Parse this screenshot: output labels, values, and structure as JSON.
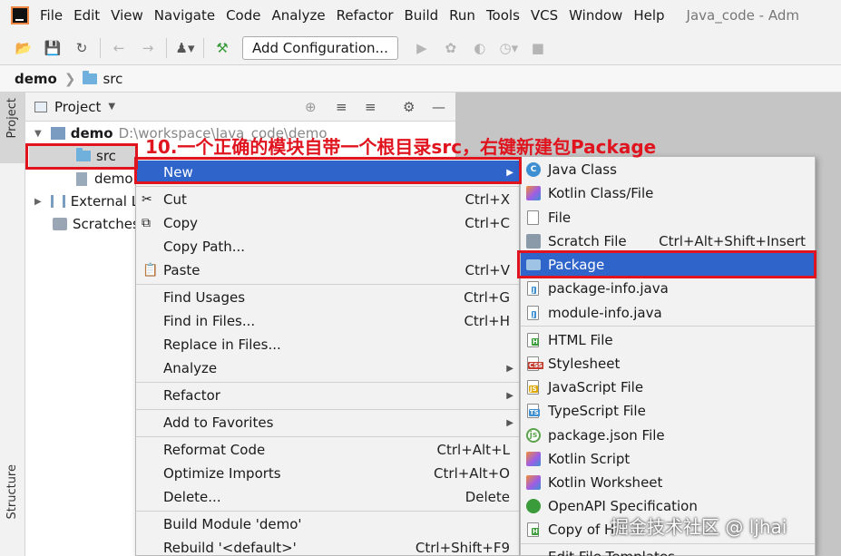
{
  "menubar": {
    "items": [
      "File",
      "Edit",
      "View",
      "Navigate",
      "Code",
      "Analyze",
      "Refactor",
      "Build",
      "Run",
      "Tools",
      "VCS",
      "Window",
      "Help"
    ],
    "window_title": "Java_code - Adm"
  },
  "toolbar": {
    "run_config_label": "Add Configuration...",
    "icons": [
      "open-icon",
      "save-icon",
      "sync-icon",
      "back-icon",
      "forward-icon",
      "user-icon",
      "build-hammer-icon",
      "run-icon",
      "debug-icon",
      "coverage-icon",
      "profile-icon",
      "stop-icon"
    ]
  },
  "breadcrumb": {
    "project": "demo",
    "folder": "src"
  },
  "side_strip": {
    "project_tab": "Project",
    "structure_tab": "Structure"
  },
  "project_panel": {
    "title": "Project",
    "tree": {
      "root_name": "demo",
      "root_path": "D:\\workspace\\Java_code\\demo",
      "src": "src",
      "iml": "demo",
      "external": "External L",
      "scratches": "Scratches"
    }
  },
  "annotation": "10.一个正确的模块自带一个根目录src，右键新建包Package",
  "context_menu": {
    "new": "New",
    "cut": "Cut",
    "cut_sc": "Ctrl+X",
    "copy": "Copy",
    "copy_sc": "Ctrl+C",
    "copy_path": "Copy Path...",
    "paste": "Paste",
    "paste_sc": "Ctrl+V",
    "find_usages": "Find Usages",
    "find_usages_sc": "Ctrl+G",
    "find_in_files": "Find in Files...",
    "find_in_files_sc": "Ctrl+H",
    "replace_in_files": "Replace in Files...",
    "analyze": "Analyze",
    "refactor": "Refactor",
    "add_to_favorites": "Add to Favorites",
    "reformat_code": "Reformat Code",
    "reformat_code_sc": "Ctrl+Alt+L",
    "optimize_imports": "Optimize Imports",
    "optimize_imports_sc": "Ctrl+Alt+O",
    "delete": "Delete...",
    "delete_sc": "Delete",
    "build_module": "Build Module 'demo'",
    "rebuild": "Rebuild '<default>'",
    "rebuild_sc": "Ctrl+Shift+F9"
  },
  "new_submenu": {
    "java_class": "Java Class",
    "kotlin_class": "Kotlin Class/File",
    "file": "File",
    "scratch_file": "Scratch File",
    "scratch_file_sc": "Ctrl+Alt+Shift+Insert",
    "package": "Package",
    "package_info": "package-info.java",
    "module_info": "module-info.java",
    "html_file": "HTML File",
    "stylesheet": "Stylesheet",
    "javascript_file": "JavaScript File",
    "typescript_file": "TypeScript File",
    "package_json": "package.json File",
    "kotlin_script": "Kotlin Script",
    "kotlin_worksheet": "Kotlin Worksheet",
    "openapi": "OpenAPI Specification",
    "copy_of": "Copy of H",
    "edit_templates": "Edit File Templates..."
  },
  "watermark": "掘金技术社区 @ ljhai",
  "colors": {
    "selection": "#2f65ca",
    "annotation_red": "#e0141e",
    "folder_blue": "#6fb0dc"
  }
}
